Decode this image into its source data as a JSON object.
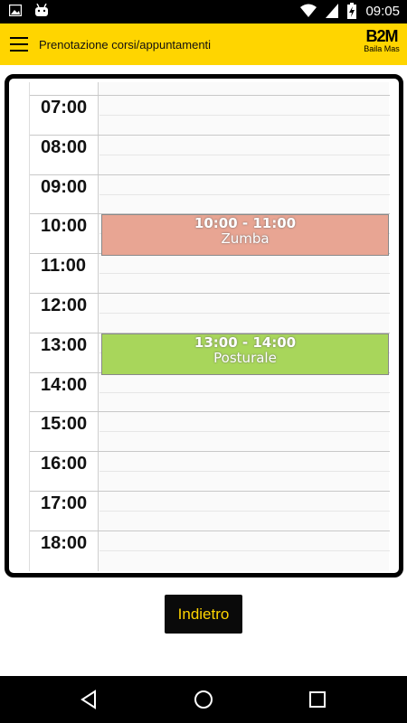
{
  "status_bar": {
    "time": "09:05",
    "icons": [
      "image-notification-icon",
      "android-robot-icon",
      "wifi-icon",
      "signal-icon",
      "battery-charging-icon"
    ]
  },
  "app_bar": {
    "title": "Prenotazione corsi/appuntamenti",
    "logo_main": "B2M",
    "logo_sub": "Baila Mas",
    "accent_color": "#ffd500"
  },
  "calendar": {
    "hours": [
      "07:00",
      "08:00",
      "09:00",
      "10:00",
      "11:00",
      "12:00",
      "13:00",
      "14:00",
      "15:00",
      "16:00",
      "17:00",
      "18:00"
    ],
    "events": [
      {
        "time": "10:00 - 11:00",
        "name": "Zumba",
        "color": "#e8a593"
      },
      {
        "time": "13:00 - 14:00",
        "name": "Posturale",
        "color": "#a8d65b"
      }
    ]
  },
  "actions": {
    "back_label": "Indietro"
  }
}
